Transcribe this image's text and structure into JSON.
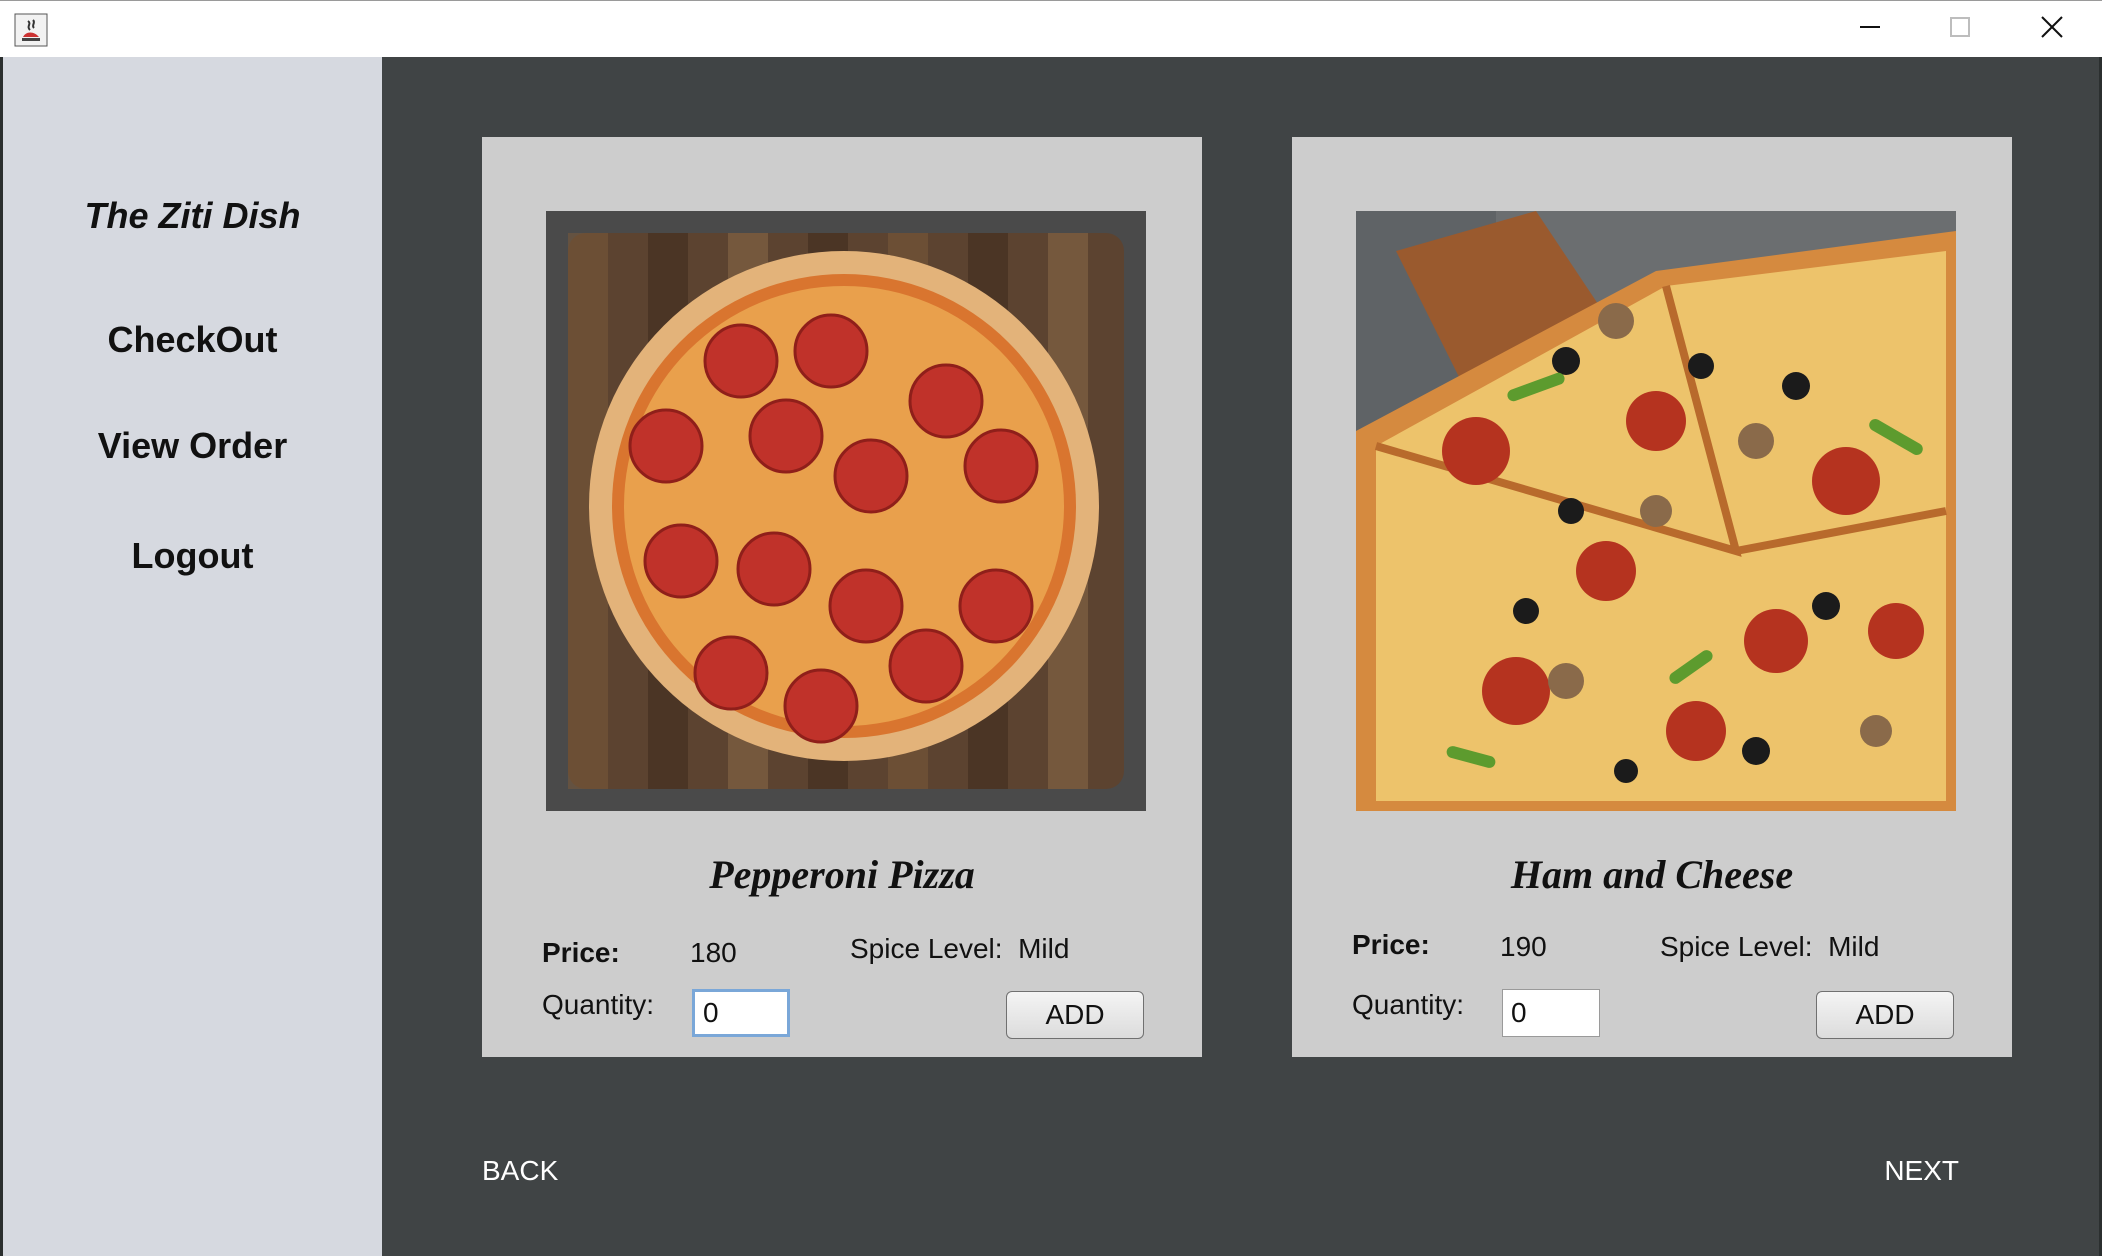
{
  "window": {
    "minimize_icon": "minimize-icon",
    "maximize_icon": "maximize-icon",
    "close_icon": "close-icon",
    "app_icon": "java-app-icon"
  },
  "sidebar": {
    "brand": "The Ziti Dish",
    "items": [
      {
        "label": "CheckOut"
      },
      {
        "label": "View Order"
      },
      {
        "label": "Logout"
      }
    ]
  },
  "products": [
    {
      "name": "Pepperoni Pizza",
      "price_label": "Price:",
      "price": "180",
      "spice_label": "Spice Level:",
      "spice": "Mild",
      "quantity_label": "Quantity:",
      "quantity": "0",
      "add_label": "ADD",
      "image": "pepperoni-pizza-photo"
    },
    {
      "name": "Ham and Cheese",
      "price_label": "Price:",
      "price": "190",
      "spice_label": "Spice Level:",
      "spice": "Mild",
      "quantity_label": "Quantity:",
      "quantity": "0",
      "add_label": "ADD",
      "image": "ham-and-cheese-pizza-photo"
    }
  ],
  "footer": {
    "back_label": "BACK",
    "next_label": "NEXT"
  },
  "colors": {
    "sidebar_bg": "#d6d9e0",
    "main_bg": "#404445",
    "card_bg": "#cdcdcd"
  }
}
